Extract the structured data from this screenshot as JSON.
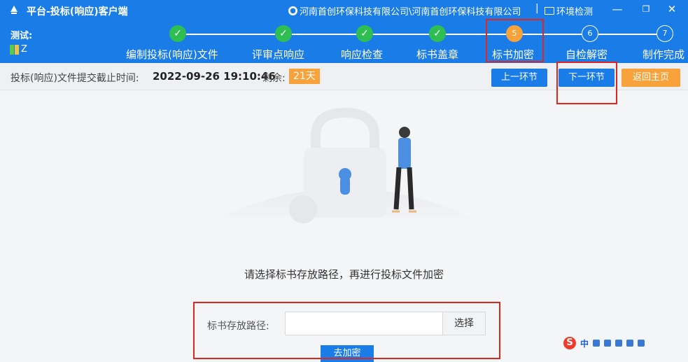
{
  "window": {
    "title": "平台-投标(响应)客户端",
    "user": "河南首创环保科技有限公司\\河南首创环保科技有限公司",
    "separator": "|",
    "env_check": "环境检测",
    "min_glyph": "—",
    "max_glyph": "❐",
    "close_glyph": "✕"
  },
  "sidebar_tags": {
    "test_label": "测试:",
    "z_label": "Z"
  },
  "steps": [
    {
      "label": "编制投标(响应)文件",
      "marker": "✓",
      "state": "done"
    },
    {
      "label": "评审点响应",
      "marker": "✓",
      "state": "done"
    },
    {
      "label": "响应检查",
      "marker": "✓",
      "state": "done"
    },
    {
      "label": "标书盖章",
      "marker": "✓",
      "state": "done"
    },
    {
      "label": "标书加密",
      "marker": "5",
      "state": "active"
    },
    {
      "label": "自检解密",
      "marker": "6",
      "state": "todo"
    },
    {
      "label": "制作完成",
      "marker": "7",
      "state": "todo"
    }
  ],
  "infobar": {
    "deadline_label": "投标(响应)文件提交截止时间:",
    "deadline_value": "2022-09-26 19:10:46",
    "remain_label": "剩余:",
    "remain_value": "21天",
    "prev_label": "上一环节",
    "next_label": "下一环节",
    "home_label": "返回主页"
  },
  "main": {
    "hint": "请选择标书存放路径，再进行投标文件加密",
    "field_label": "标书存放路径:",
    "path_value": "",
    "choose_label": "选择",
    "encrypt_label": "去加密"
  },
  "ime": {
    "logo": "S",
    "mode": "中"
  },
  "colors": {
    "primary": "#1a7ce6",
    "accent": "#f7a23a",
    "done": "#2fbe52",
    "highlight": "#e0271f"
  }
}
